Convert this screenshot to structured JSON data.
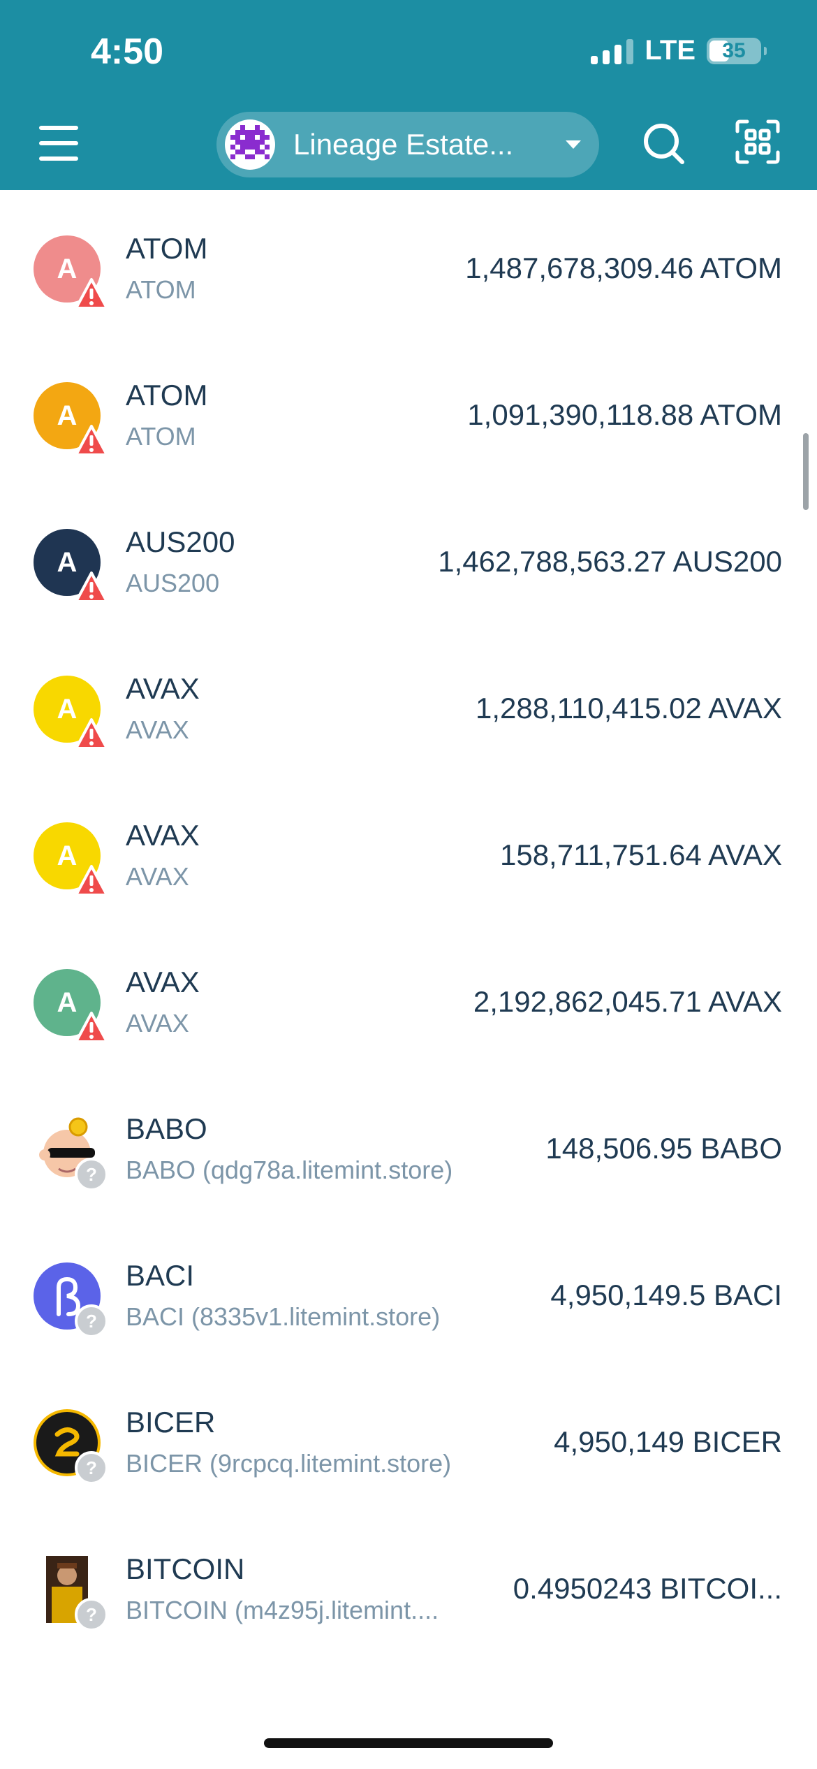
{
  "status_bar": {
    "time": "4:50",
    "network": "LTE",
    "battery": "35"
  },
  "header": {
    "wallet_name": "Lineage Estate..."
  },
  "tokens": [
    {
      "name": "ATOM",
      "subtitle": "ATOM",
      "amount": "1,487,678,309.46 ATOM",
      "icon_letter": "A",
      "icon_color": "#ef8c8c",
      "badge": "warning"
    },
    {
      "name": "ATOM",
      "subtitle": "ATOM",
      "amount": "1,091,390,118.88 ATOM",
      "icon_letter": "A",
      "icon_color": "#f3a712",
      "badge": "warning"
    },
    {
      "name": "AUS200",
      "subtitle": "AUS200",
      "amount": "1,462,788,563.27 AUS200",
      "icon_letter": "A",
      "icon_color": "#1f3552",
      "badge": "warning"
    },
    {
      "name": "AVAX",
      "subtitle": "AVAX",
      "amount": "1,288,110,415.02 AVAX",
      "icon_letter": "A",
      "icon_color": "#f8d800",
      "badge": "warning"
    },
    {
      "name": "AVAX",
      "subtitle": "AVAX",
      "amount": "158,711,751.64 AVAX",
      "icon_letter": "A",
      "icon_color": "#f8d800",
      "badge": "warning"
    },
    {
      "name": "AVAX",
      "subtitle": "AVAX",
      "amount": "2,192,862,045.71 AVAX",
      "icon_letter": "A",
      "icon_color": "#5fb38c",
      "badge": "warning"
    },
    {
      "name": "BABO",
      "subtitle": "BABO (qdg78a.litemint.store)",
      "amount": "148,506.95 BABO",
      "icon": "babo-avatar-icon",
      "badge": "unknown"
    },
    {
      "name": "BACI",
      "subtitle": "BACI (8335v1.litemint.store)",
      "amount": "4,950,149.5 BACI",
      "icon": "baci-logo-icon",
      "icon_color": "#5b63e8",
      "badge": "unknown"
    },
    {
      "name": "BICER",
      "subtitle": "BICER (9rcpcq.litemint.store)",
      "amount": "4,950,149 BICER",
      "icon": "bicer-logo-icon",
      "icon_color": "#1a1a1a",
      "badge": "unknown"
    },
    {
      "name": "BITCOIN",
      "subtitle": "BITCOIN (m4z95j.litemint....",
      "amount": "0.4950243 BITCOI...",
      "icon": "bitcoin-photo-icon",
      "badge": "unknown"
    }
  ]
}
